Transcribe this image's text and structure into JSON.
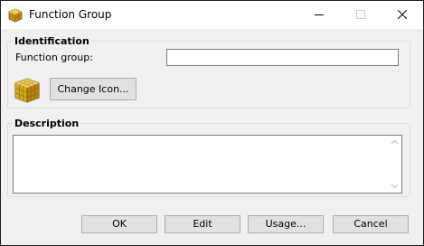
{
  "window": {
    "title": "Function Group",
    "app_icon": "cube-icon",
    "controls": {
      "minimize": "minimize-icon",
      "maximize": "maximize-icon",
      "close": "close-icon"
    }
  },
  "identification": {
    "group_title": "Identification",
    "function_group_label": "Function group:",
    "function_group_value": "",
    "icon": "cube-icon",
    "change_icon_label": "Change Icon..."
  },
  "description": {
    "group_title": "Description",
    "value": ""
  },
  "buttons": {
    "ok": "OK",
    "edit": "Edit",
    "usage": "Usage...",
    "cancel": "Cancel"
  },
  "colors": {
    "dialog_bg": "#f0f0f0",
    "button_bg": "#e1e1e1",
    "button_border": "#adadad",
    "cube_gold": "#d9a820"
  }
}
